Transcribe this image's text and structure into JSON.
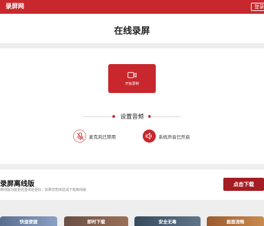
{
  "header": {
    "brand": "录屏网",
    "login": "登录"
  },
  "page_title": "在线录屏",
  "record": {
    "label": "开始录制",
    "icon": "video-camera-icon"
  },
  "audio": {
    "title": "设置音频",
    "mic_label": "麦克风已禁用",
    "mic_icon": "mic-muted-icon",
    "system_label": "系统声音已开启",
    "system_icon": "speaker-icon"
  },
  "promo": {
    "title": "录屏离线版",
    "description": "离线版功能更完善体验更好，如果您想体验请下载离线版",
    "button": "点击下载"
  },
  "features": [
    "快速便捷",
    "即时下载",
    "安全无毒",
    "画面流畅"
  ],
  "colors": {
    "accent": "#c8282d",
    "download": "#a31d23"
  }
}
